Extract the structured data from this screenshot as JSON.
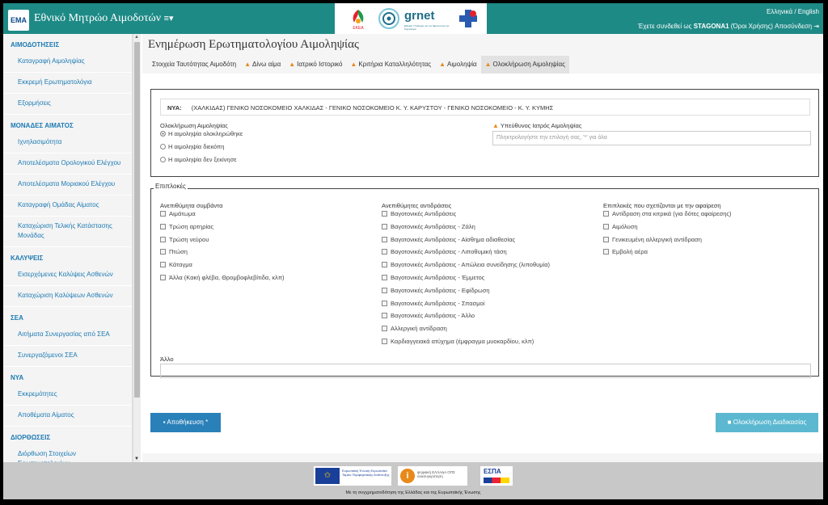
{
  "header": {
    "logo_text": "ΕΜΑ",
    "title": "Εθνικό Μητρώο Αιμοδοτών",
    "menu_caret": "≡▾",
    "eaea_label": "ΕΚΕΑ",
    "grnet_label": "grnet",
    "grnet_sub": "Εθνικές Υποδομές για την Έρευνα και την Τεχνολογία",
    "language": "Ελληνικά / English",
    "login_prefix": "Έχετε συνδεθεί ως",
    "username": "STAGONA1",
    "terms_link": "(Όροι Χρήσης)",
    "logout_label": "Αποσύνδεση"
  },
  "sidebar": {
    "sections": [
      {
        "title": "ΑΙΜΟΔΟΤΗΣΕΙΣ",
        "items": [
          "Καταγραφή Αιμοληψίας",
          "Εκκρεμή Ερωτηματολόγια",
          "Εξορμήσεις"
        ]
      },
      {
        "title": "ΜΟΝΑΔΕΣ ΑΙΜΑΤΟΣ",
        "items": [
          "Ιχνηλασιμότητα",
          "Αποτελέσματα Ορολογικού Ελέγχου",
          "Αποτελέσματα Μοριακού Ελέγχου",
          "Καταγραφή Ομάδας Αίματος",
          "Καταχώριση Τελικής Κατάστασης Μονάδας"
        ]
      },
      {
        "title": "ΚΑΛΥΨΕΙΣ",
        "items": [
          "Εισερχόμενες Καλύψεις Ασθενών",
          "Καταχώριση Καλύψεων Ασθενών"
        ]
      },
      {
        "title": "ΣΕΑ",
        "items": [
          "Αιτήματα Συνεργασίας από ΣΕΑ",
          "Συνεργαζόμενοι ΣΕΑ"
        ]
      },
      {
        "title": "ΝΥΑ",
        "items": [
          "Εκκρεμότητες",
          "Αποθέματα Αίματος"
        ]
      },
      {
        "title": "ΔΙΟΡΘΩΣΕΙΣ",
        "items": [
          "Διόρθωση Στοιχείων Ερωτηματολογίων"
        ]
      }
    ]
  },
  "page": {
    "title": "Ενημέρωση Ερωτηματολογίου Αιμοληψίας",
    "tabs": [
      {
        "label": "Στοιχεία Ταυτότητας Αιμοδότη",
        "warn": false
      },
      {
        "label": "Δίνω αίμα",
        "warn": true
      },
      {
        "label": "Ιατρικό Ιστορικό",
        "warn": true
      },
      {
        "label": "Κριτήρια Καταλληλότητας",
        "warn": true
      },
      {
        "label": "Αιμοληψία",
        "warn": true
      },
      {
        "label": "Ολοκλήρωση Αιμοληψίας",
        "warn": true,
        "active": true
      }
    ]
  },
  "panel1": {
    "nya_label": "ΝΥΑ:",
    "nya_value": "(ΧΑΛΚΙΔΑΣ) ΓΕΝΙΚΟ ΝΟΣΟΚΟΜΕΙΟ ΧΑΛΚΙΔΑΣ - ΓΕΝΙΚΟ ΝΟΣΟΚΟΜΕΙΟ Κ. Υ. ΚΑΡΥΣΤΟΥ - ΓΕΝΙΚΟ ΝΟΣΟΚΟΜΕΙΟ - Κ. Υ. ΚΥΜΗΣ",
    "completion_label": "Ολοκλήρωση Αιμοληψίας",
    "radios": [
      {
        "label": "Η αιμοληψία ολοκληρώθηκε",
        "checked": true
      },
      {
        "label": "Η αιμοληψία διεκόπη",
        "checked": false
      },
      {
        "label": "Η αιμοληψία δεν ξεκίνησε",
        "checked": false
      }
    ],
    "doctor_label": "Υπεύθυνος Ιατρός Αιμοληψίας",
    "doctor_placeholder": "Πληκτρολογήστε την επιλογή σας, '*' για όλα"
  },
  "panel2": {
    "legend": "Επιπλοκές",
    "col1_title": "Ανεπιθύμητα συμβάντα",
    "col1": [
      "Αιμάτωμα",
      "Τρώση αρτηρίας",
      "Τρώση νεύρου",
      "Πτώση",
      "Κάταγμα",
      "Άλλα (Κακή φλέβα, Θρομβοφλεβίτιδα, κλπ)"
    ],
    "col2_title": "Ανεπιθύμητες αντιδράσεις",
    "col2": [
      "Βαγοτονικές Αντιδράσεις",
      "Βαγοτονικές Αντιδράσεις - Ζάλη",
      "Βαγοτονικές Αντιδράσεις - Αίσθημα αδιαθεσίας",
      "Βαγοτονικές Αντιδράσεις - Λιποθυμική τάση",
      "Βαγοτονικές Αντιδράσεις - Απώλεια συνείδησης (λιποθυμία)",
      "Βαγοτονικές Αντιδράσεις - Έμμετος",
      "Βαγοτονικές Αντιδράσεις - Εφίδρωση",
      "Βαγοτονικές Αντιδράσεις - Σπασμοί",
      "Βαγοτονικές Αντιδράσεις - Άλλο",
      "Αλλεργική αντίδραση",
      "Καρδιαγγειακά ατύχημα (έμφραγμα μυοκαρδίου, κλπ)"
    ],
    "col3_title": "Επιπλοκές που σχετίζονται με την αφαίρεση",
    "col3": [
      "Αντίδραση στα κιτρικά (για δότες αφαίρεσης)",
      "Αιμόλυση",
      "Γενικευμένη αλλεργική αντίδραση",
      "Εμβολή αέρα"
    ],
    "other_label": "Άλλο"
  },
  "buttons": {
    "save": "Αποθήκευση *",
    "finish": "Ολοκλήρωση Διαδικασίας"
  },
  "footer": {
    "eu_text": "Ευρωπαϊκή Ένωση Ευρωπαϊκό Ταμείο Περιφερειακής Ανάπτυξης",
    "digital_text": "ψηφιακή ΕΛΛΑΔΑ ΟΠΣ ανασυγκρότηση",
    "espa_text": "ΕΣΠΑ",
    "caption": "Με τη συγχρηματοδότηση της Ελλάδας και της Ευρωπαϊκής Ένωσης"
  },
  "colors": {
    "header": "#1e8a86",
    "link": "#1c7ab3",
    "primary_button": "#2a80b9",
    "info_button": "#5bb8d0",
    "warning": "#e8891a"
  }
}
